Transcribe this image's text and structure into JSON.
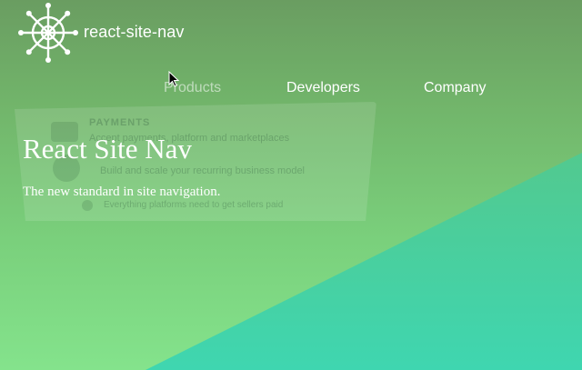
{
  "brand": {
    "name": "react-site-nav",
    "logo_icon": "ship-wheel-icon"
  },
  "nav": {
    "items": [
      {
        "label": "Products",
        "state": "hovered"
      },
      {
        "label": "Developers",
        "state": "default"
      },
      {
        "label": "Company",
        "state": "default"
      }
    ]
  },
  "dropdown": {
    "heading": "PAYMENTS",
    "lines": [
      "Accept payments, platform and marketplaces",
      "Build and scale your recurring business model",
      "Everything platforms need to get sellers paid"
    ]
  },
  "hero": {
    "title": "React Site Nav",
    "subtitle": "The new standard in site navigation."
  },
  "colors": {
    "text": "#ffffff",
    "gradient_top": "#6a9d61",
    "gradient_bottom": "#84e38c",
    "wedge": "#3fd0a8"
  },
  "cursor_icon": "arrow-cursor-icon"
}
